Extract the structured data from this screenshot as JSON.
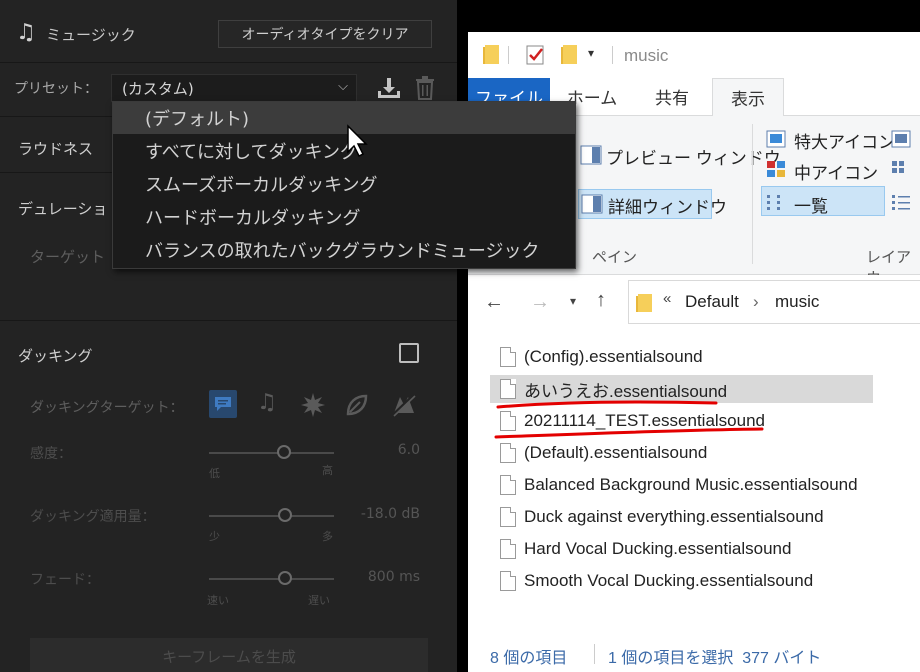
{
  "premiere": {
    "section_title": "ミュージック",
    "clear_button": "オーディオタイプをクリア",
    "preset_label": "プリセット：",
    "preset_value": "(カスタム)",
    "loudness_label": "ラウドネス",
    "duration_label": "デュレーショ",
    "target_label": "ターゲット",
    "ducking_label": "ダッキング",
    "ducking_target_label": "ダッキングターゲット：",
    "sensitivity_label": "感度：",
    "sensitivity_value": "6.0",
    "sensitivity_min": "低",
    "sensitivity_max": "高",
    "amount_label": "ダッキング適用量：",
    "amount_value": "-18.0 dB",
    "amount_min": "少",
    "amount_max": "多",
    "fade_label": "フェード：",
    "fade_value": "800 ms",
    "fade_min": "速い",
    "fade_max": "遅い",
    "keyframe_button": "キーフレームを生成",
    "dropdown": {
      "items": [
        "(デフォルト)",
        "すべてに対してダッキング",
        "スムーズボーカルダッキング",
        "ハードボーカルダッキング",
        "バランスの取れたバックグラウンドミュージック"
      ],
      "selected_index": 0
    }
  },
  "explorer": {
    "title": "music",
    "tabs": [
      "ファイル",
      "ホーム",
      "共有",
      "表示"
    ],
    "active_tab": "表示",
    "ribbon": {
      "preview_pane": "プレビュー ウィンドウ",
      "details_pane": "詳細ウィンドウ",
      "pane_group": "ペイン",
      "extra_large_icons": "特大アイコン",
      "medium_icons": "中アイコン",
      "list": "一覧",
      "layout_group": "レイアウ"
    },
    "breadcrumb": [
      "Default",
      "music"
    ],
    "files": [
      "(Config).essentialsound",
      "あいうえお.essentialsound",
      "20211114_TEST.essentialsound",
      "(Default).essentialsound",
      "Balanced Background Music.essentialsound",
      "Duck against everything.essentialsound",
      "Hard Vocal Ducking.essentialsound",
      "Smooth Vocal Ducking.essentialsound"
    ],
    "selected_file_index": 1,
    "status": {
      "item_count": "8 個の項目",
      "selection": "1 個の項目を選択  377 バイト"
    }
  },
  "colors": {
    "premiere_bg": "#232323",
    "explorer_file_tab": "#1a66c4",
    "annotation_red": "#e30000"
  }
}
